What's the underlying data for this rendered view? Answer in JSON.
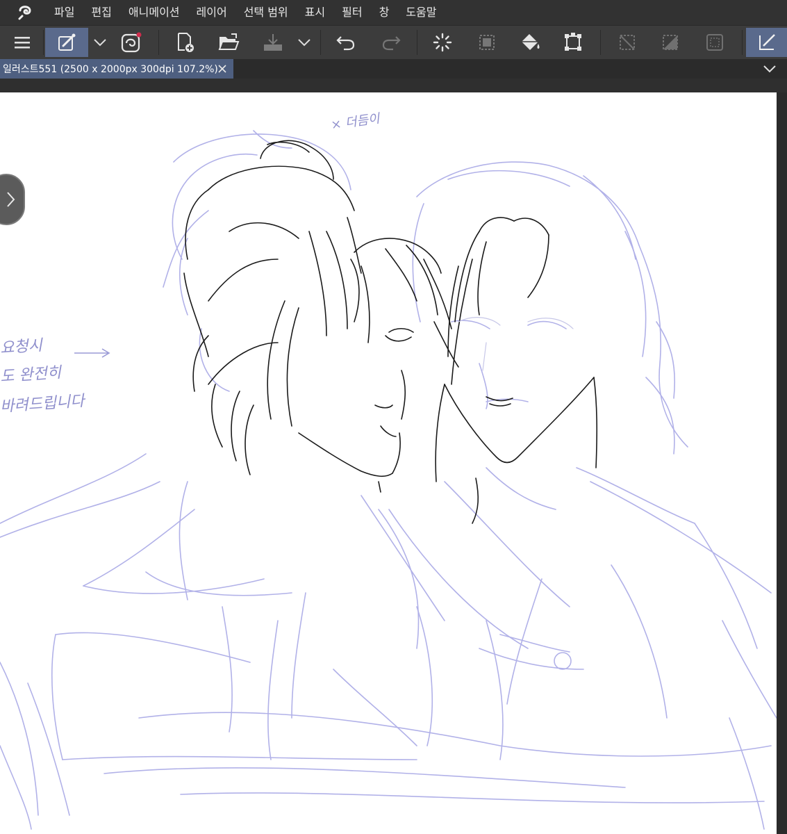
{
  "menu": {
    "logo_icon": "clip-studio-logo-icon",
    "items": [
      "파일",
      "편집",
      "애니메이션",
      "레이어",
      "선택 범위",
      "표시",
      "필터",
      "창",
      "도움말"
    ]
  },
  "toolbar": {
    "icons": [
      "hamburger-menu-icon",
      "edit-brush-icon",
      "chevron-down-icon",
      "clip-studio-assets-icon",
      "new-canvas-icon",
      "open-folder-icon",
      "save-icon",
      "chevron-down-icon",
      "undo-icon",
      "redo-icon",
      "deselect-icon",
      "convert-selection-icon",
      "fill-icon",
      "transform-icon",
      "clear-outside-selection-icon",
      "fill-selection-icon",
      "snap-icon",
      "pen-tool-icon"
    ]
  },
  "document_tab": {
    "label": "일러스트551 (2500 x 2000px 300dpi 107.2%)"
  },
  "canvas": {
    "notes": [
      "× 더듬이",
      "요청시",
      "도 완전히",
      "바려드립니다"
    ]
  },
  "colors": {
    "menubar_bg": "#323232",
    "toolbar_bg": "#3c3c3c",
    "active_tool": "#5a6a8c",
    "tab_active": "#4e5f80",
    "sketch_blue": "#a9a9e6",
    "lineart": "#1a1a1a"
  }
}
